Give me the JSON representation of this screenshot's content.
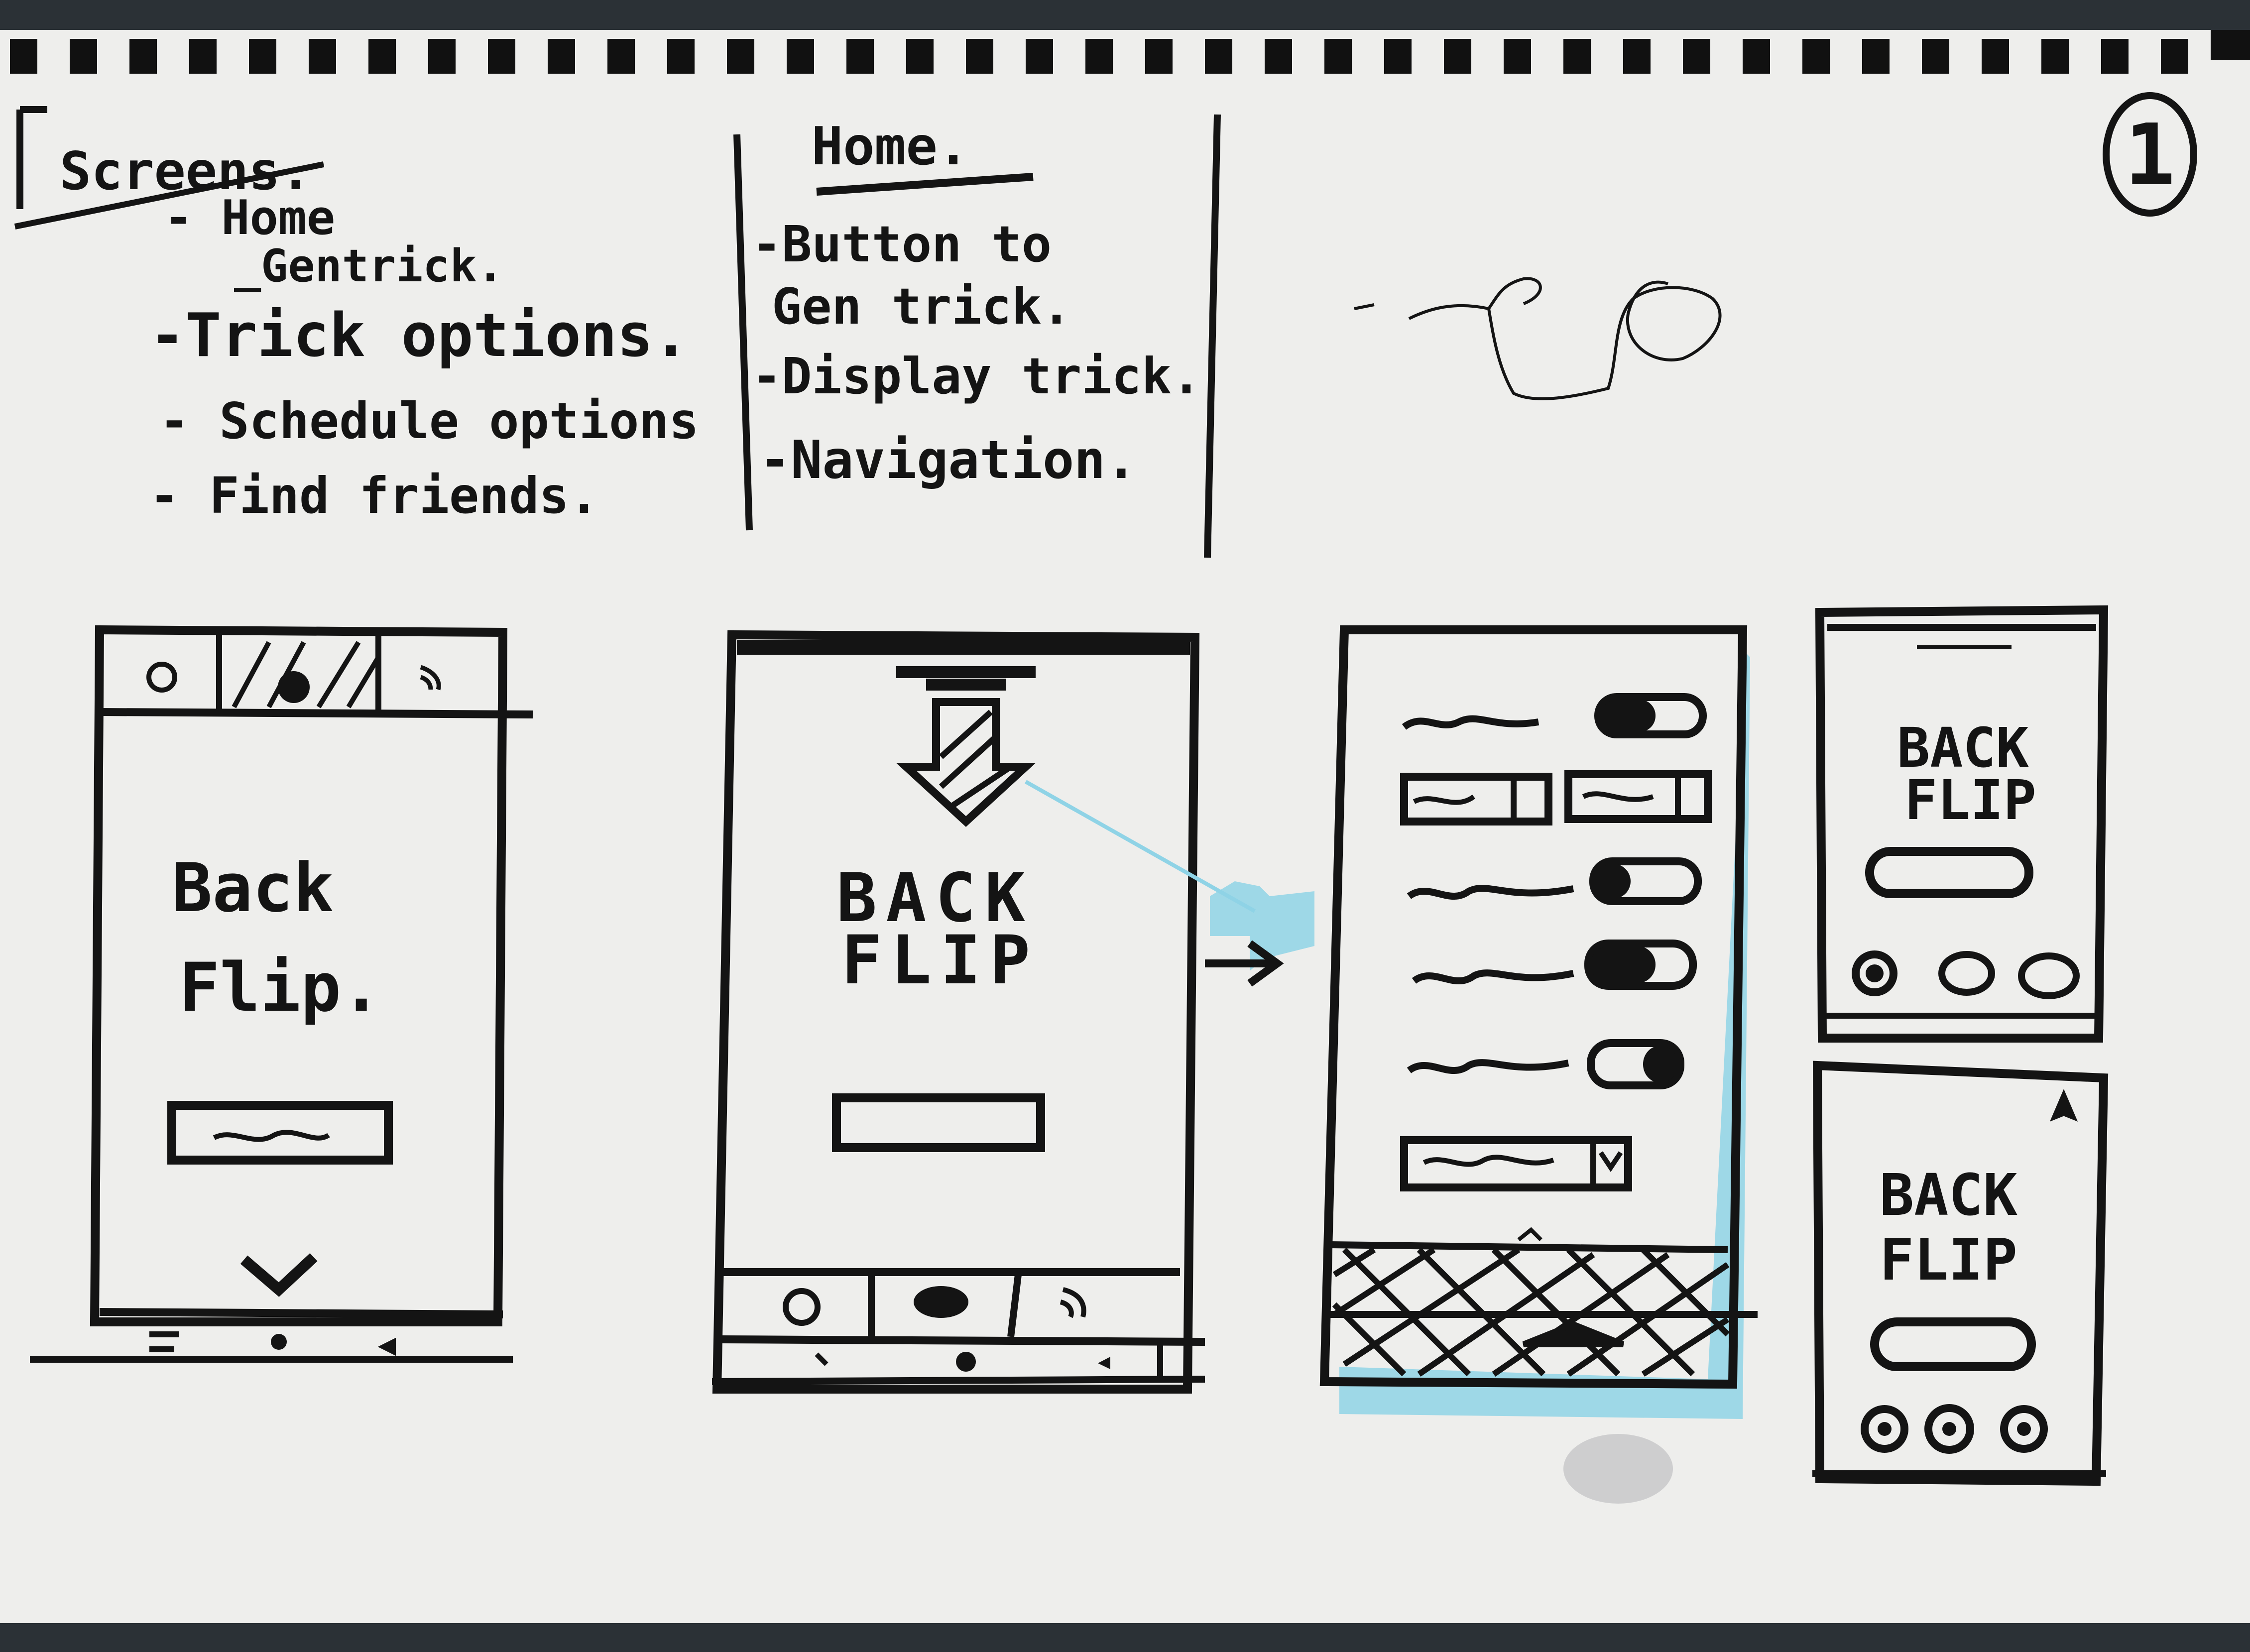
{
  "page_number": "1",
  "notes": {
    "screens": {
      "title": "Screens.",
      "items": [
        "- Home",
        "_Gentrick.",
        "-Trick options.",
        "- Schedule options",
        "- Find friends."
      ]
    },
    "home": {
      "title": "Home.",
      "items": [
        "-Button to",
        "Gen trick.",
        "-Display trick.",
        "-Navigation."
      ]
    }
  },
  "wireframes": {
    "screen_one": {
      "trick": [
        "Back",
        "Flip."
      ]
    },
    "screen_two": {
      "trick": [
        "BACK",
        "FLIP"
      ]
    },
    "screen_small_top": {
      "trick": [
        "BACK",
        "FLIP"
      ]
    },
    "screen_small_bottom": {
      "trick": [
        "BACK",
        "FLIP"
      ]
    }
  },
  "colors": {
    "paper": "#eeeeec",
    "ink": "#141414",
    "highlight": "#8fd3e6",
    "background": "#2b3136"
  }
}
